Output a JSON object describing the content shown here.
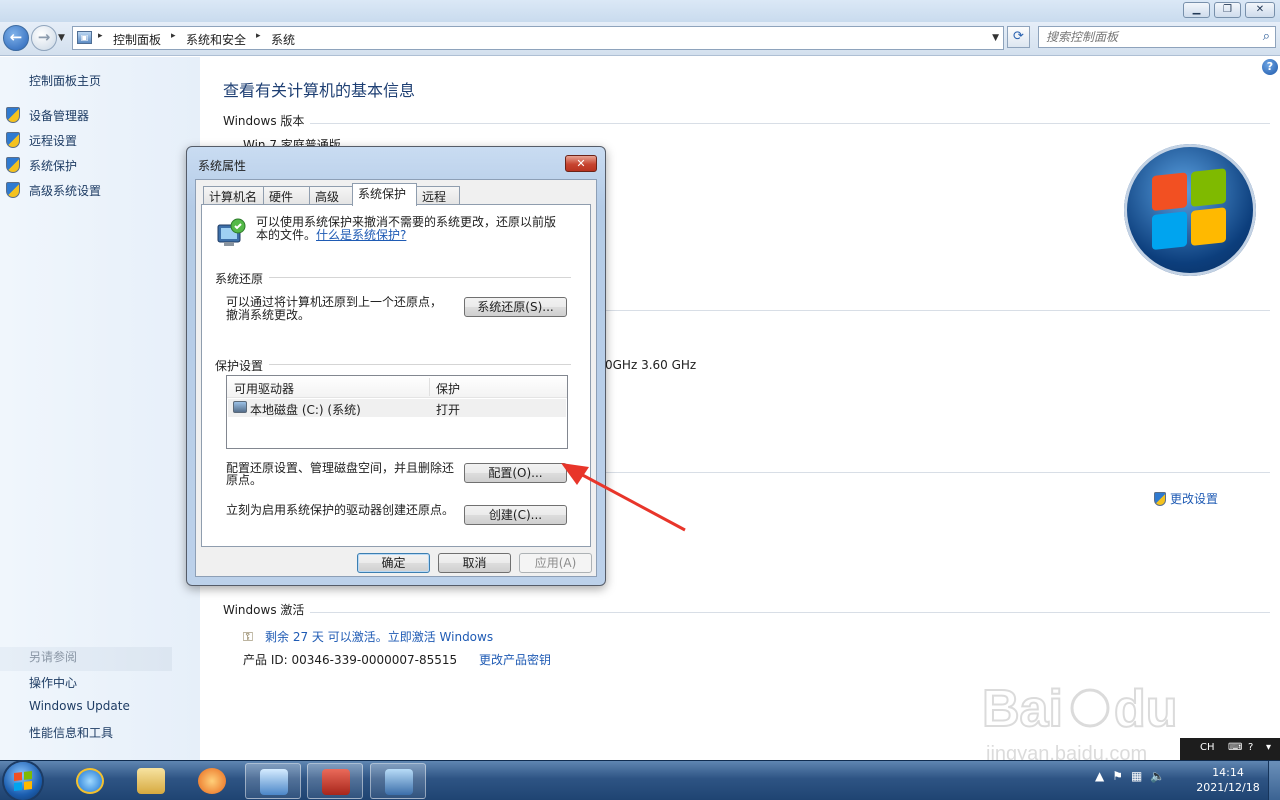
{
  "window": {
    "controls": {
      "minimize": "▁",
      "maximize": "❐",
      "close": "✕"
    }
  },
  "address_bar": {
    "crumbs": [
      "控制面板",
      "系统和安全",
      "系统"
    ],
    "separator": "▸",
    "search_placeholder": "搜索控制面板"
  },
  "sidebar": {
    "home": "控制面板主页",
    "items": [
      "设备管理器",
      "远程设置",
      "系统保护",
      "高级系统设置"
    ],
    "see_also_title": "另请参阅",
    "see_also": [
      "操作中心",
      "Windows Update",
      "性能信息和工具"
    ]
  },
  "main": {
    "title": "查看有关计算机的基本信息",
    "edition_heading": "Windows 版本",
    "edition_visible": "Win    7 家庭普通版",
    "cpu_speed": "0GHz   3.60 GHz",
    "change_settings": "更改设置",
    "activation_heading": "Windows 激活",
    "activation_text": "剩余 27 天 可以激活。立即激活 Windows",
    "product_id_label": "产品 ID: 00346-339-0000007-85515",
    "change_key": "更改产品密钥"
  },
  "dialog": {
    "title": "系统属性",
    "tabs": [
      "计算机名",
      "硬件",
      "高级",
      "系统保护",
      "远程"
    ],
    "active_tab": "系统保护",
    "description_line1": "可以使用系统保护来撤消不需要的系统更改，还原以前版",
    "description_line2": "本的文件。",
    "description_link": "什么是系统保护?",
    "restore_group": "系统还原",
    "restore_text_1": "可以通过将计算机还原到上一个还原点，",
    "restore_text_2": "撤消系统更改。",
    "restore_button": "系统还原(S)...",
    "protect_group": "保护设置",
    "list_columns": [
      "可用驱动器",
      "保护"
    ],
    "drives": [
      {
        "name": "本地磁盘 (C:) (系统)",
        "protection": "打开"
      }
    ],
    "config_text_1": "配置还原设置、管理磁盘空间，并且删除还",
    "config_text_2": "原点。",
    "config_button": "配置(O)...",
    "create_text": "立刻为启用系统保护的驱动器创建还原点。",
    "create_button": "创建(C)...",
    "ok_button": "确定",
    "cancel_button": "取消",
    "apply_button": "应用(A)"
  },
  "taskbar": {
    "clock_time": "14:14",
    "clock_date": "2021/12/18",
    "language": "CH"
  },
  "annotation_color": "#e8352a"
}
